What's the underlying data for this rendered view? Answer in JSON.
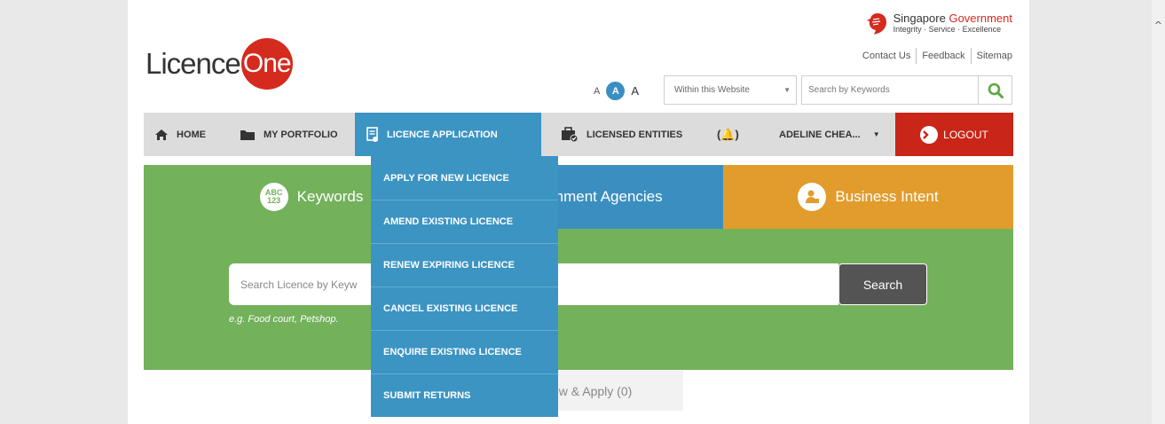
{
  "header": {
    "logo_text": "Licence",
    "logo_circle_text": "One",
    "gov_title_part1": "Singapore ",
    "gov_title_part2": "Government",
    "gov_tagline": "Integrity · Service · Excellence",
    "links": [
      "Contact Us",
      "Feedback",
      "Sitemap"
    ],
    "font_sizes": [
      "A",
      "A",
      "A"
    ],
    "scope_select": "Within this Website",
    "keyword_placeholder": "Search by Keywords"
  },
  "nav": {
    "home": "HOME",
    "portfolio": "MY PORTFOLIO",
    "licence_application": "LICENCE APPLICATION",
    "licensed_entities": "LICENSED ENTITIES",
    "user": "ADELINE CHEA...",
    "logout": "LOGOUT"
  },
  "dropdown": {
    "items": [
      "APPLY FOR NEW LICENCE",
      "AMEND EXISTING LICENCE",
      "RENEW EXPIRING LICENCE",
      "CANCEL EXISTING LICENCE",
      "ENQUIRE EXISTING LICENCE",
      "SUBMIT RETURNS"
    ]
  },
  "tabs": {
    "keywords": "Keywords",
    "keywords_icon_top": "ABC",
    "keywords_icon_bottom": "123",
    "agencies": "rnment Agencies",
    "intent": "Business Intent"
  },
  "search": {
    "placeholder": "Search Licence by Keyw",
    "button": "Search",
    "hint": "e.g. Food court, Petshop."
  },
  "review": {
    "label": "ew & Apply (0)"
  },
  "colors": {
    "green": "#73b15b",
    "blue": "#3b94c2",
    "orange": "#e19c2c",
    "red": "#c92518"
  }
}
